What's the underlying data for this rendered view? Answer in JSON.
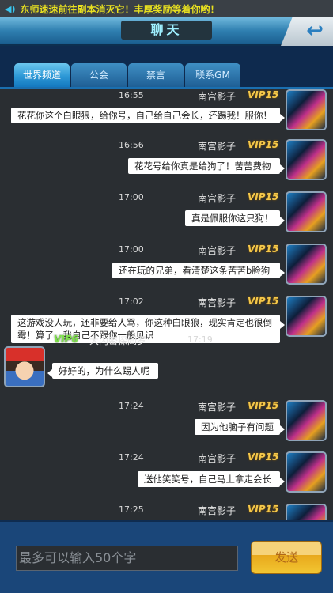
{
  "marquee": {
    "icon": "speaker-icon",
    "text": "东师速速前往副本消灭它！丰厚奖励等着你哟！"
  },
  "header": {
    "title": "聊天",
    "back_icon": "back-arrow-icon"
  },
  "tabs": [
    {
      "label": "世界频道",
      "active": true
    },
    {
      "label": "公会"
    },
    {
      "label": "禁言"
    },
    {
      "label": "联系GM"
    }
  ],
  "messages": [
    {
      "side": "right",
      "time": "16:55",
      "name": "南宫影子",
      "vip": "VIP15",
      "text": "花花你这个白眼狼，给你号，自己给自己会长，还踢我！服你！"
    },
    {
      "side": "right",
      "time": "16:56",
      "name": "南宫影子",
      "vip": "VIP15",
      "text": "花花号给你真是给狗了！苦苦费物"
    },
    {
      "side": "right",
      "time": "17:00",
      "name": "南宫影子",
      "vip": "VIP15",
      "text": "真是佩服你这只狗！"
    },
    {
      "side": "right",
      "time": "17:00",
      "name": "南宫影子",
      "vip": "VIP15",
      "text": "还在玩的兄弟，看清楚这条苦苦b脸狗"
    },
    {
      "side": "right",
      "time": "17:02",
      "name": "南宫影子",
      "vip": "VIP15",
      "text": "这游戏没人玩，还非要给人骂，你这种白眼狼，现实肯定也很倒霉！算了，我自己不跟你一般见识"
    },
    {
      "side": "left",
      "time": "17:19",
      "name": "大内密探阎罗",
      "vip": "VIP6",
      "text": "好好的，为什么踢人呢"
    },
    {
      "side": "right",
      "time": "17:24",
      "name": "南宫影子",
      "vip": "VIP15",
      "text": "因为他脑子有问题"
    },
    {
      "side": "right",
      "time": "17:24",
      "name": "南宫影子",
      "vip": "VIP15",
      "text": "送他笑笑号，自己马上拿走会长"
    },
    {
      "side": "right",
      "time": "17:25",
      "name": "南宫影子",
      "vip": "VIP15",
      "text": ""
    }
  ],
  "input": {
    "placeholder": "最多可以输入50个字"
  },
  "send_label": "发送",
  "colors": {
    "accent": "#2d98d6",
    "marquee_text": "#e8e020",
    "vip_gold": "#f5c84a",
    "vip_green": "#7ee24a"
  }
}
